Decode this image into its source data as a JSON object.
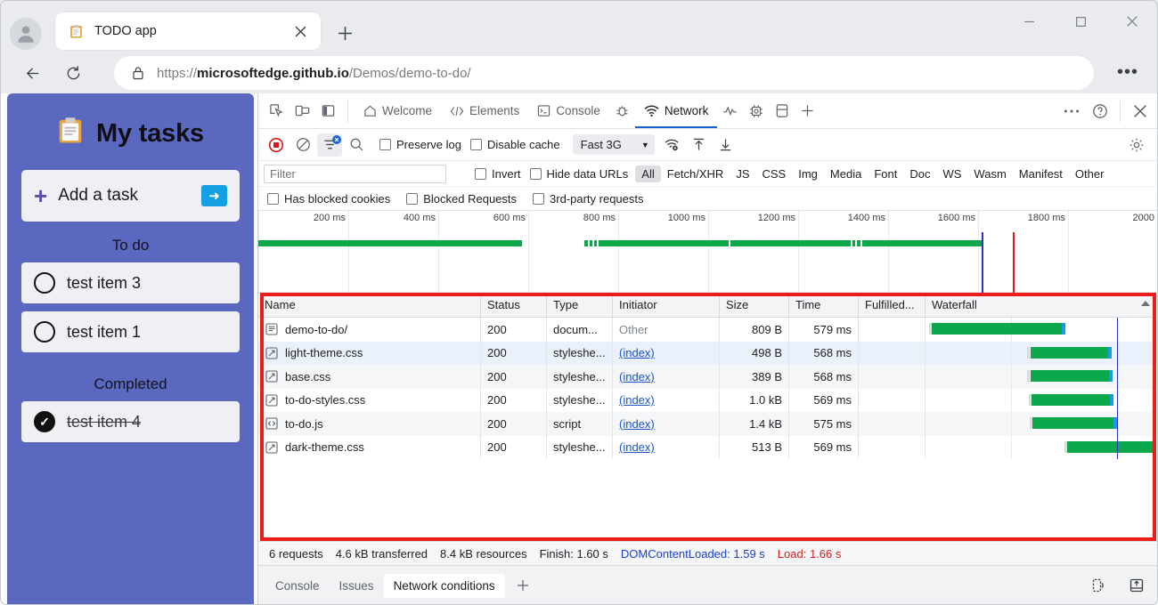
{
  "browser": {
    "tab": {
      "title": "TODO app",
      "favicon": "clipboard-icon"
    },
    "address": {
      "url_full": "https://microsoftedge.github.io/Demos/demo-to-do/",
      "url_host": "microsoftedge.github.io",
      "url_scheme": "https://",
      "url_path": "/Demos/demo-to-do/"
    },
    "buttons": {
      "back": "back-arrow",
      "reload": "reload",
      "newtab": "+",
      "more": "•••",
      "minimize": "—",
      "maximize": "□",
      "close": "✕"
    }
  },
  "todo": {
    "title": "My tasks",
    "add_label": "Add a task",
    "sections": [
      {
        "label": "To do",
        "items": [
          {
            "text": "test item 3",
            "done": false
          },
          {
            "text": "test item 1",
            "done": false
          }
        ]
      },
      {
        "label": "Completed",
        "items": [
          {
            "text": "test item 4",
            "done": true
          }
        ]
      }
    ]
  },
  "devtools": {
    "panel_tabs": [
      {
        "label": "Welcome",
        "icon": "home-icon",
        "active": false
      },
      {
        "label": "Elements",
        "icon": "code-icon",
        "active": false
      },
      {
        "label": "Console",
        "icon": "console-icon",
        "active": false
      },
      {
        "label": "Network",
        "icon": "network-wifi-icon",
        "active": true
      }
    ],
    "left_icons": [
      "inspect-element-icon",
      "device-toolbar-icon",
      "dock-side-icon"
    ],
    "extra_icons": [
      "debugger-bug-icon",
      "sources-icon",
      "performance-chip-icon",
      "application-icon",
      "add-panel-icon"
    ],
    "right_icons": [
      "more-tools-icon",
      "help-icon",
      "close-devtools-icon"
    ],
    "network_toolbar": {
      "record_label": "record-stop",
      "clear_label": "clear",
      "filter_label": "filter",
      "search_label": "search",
      "preserve_log": "Preserve log",
      "disable_cache": "Disable cache",
      "throttle_value": "Fast 3G",
      "icons": [
        "network-conditions-icon",
        "import-har-icon",
        "export-har-icon",
        "settings-gear-icon"
      ]
    },
    "filters": {
      "placeholder": "Filter",
      "invert": "Invert",
      "hide_data_urls": "Hide data URLs",
      "types": [
        "All",
        "Fetch/XHR",
        "JS",
        "CSS",
        "Img",
        "Media",
        "Font",
        "Doc",
        "WS",
        "Wasm",
        "Manifest",
        "Other"
      ],
      "selected_type": "All",
      "has_blocked_cookies": "Has blocked cookies",
      "blocked_requests": "Blocked Requests",
      "third_party": "3rd-party requests"
    },
    "overview": {
      "ticks": [
        "200 ms",
        "400 ms",
        "600 ms",
        "800 ms",
        "1000 ms",
        "1200 ms",
        "1400 ms",
        "1600 ms",
        "1800 ms",
        "2000"
      ],
      "dcl_color": "#2a31c8",
      "load_color": "#e01b1b"
    },
    "table": {
      "headers": [
        "Name",
        "Status",
        "Type",
        "Initiator",
        "Size",
        "Time",
        "Fulfilled...",
        "Waterfall"
      ],
      "sort_column": "Waterfall",
      "sort_direction": "ascending",
      "rows": [
        {
          "icon": "document-icon",
          "name": "demo-to-do/",
          "status": "200",
          "type": "docum...",
          "initiator": "Other",
          "initiator_link": false,
          "size": "809 B",
          "time": "579 ms",
          "fulfilled": "",
          "wf_start": 1.5,
          "wf_width": 56
        },
        {
          "icon": "stylesheet-icon",
          "name": "light-theme.css",
          "status": "200",
          "type": "styleshe...",
          "initiator": "(index)",
          "initiator_link": true,
          "size": "498 B",
          "time": "568 ms",
          "fulfilled": "",
          "wf_start": 44,
          "wf_width": 33.5
        },
        {
          "icon": "stylesheet-icon",
          "name": "base.css",
          "status": "200",
          "type": "styleshe...",
          "initiator": "(index)",
          "initiator_link": true,
          "size": "389 B",
          "time": "568 ms",
          "fulfilled": "",
          "wf_start": 44,
          "wf_width": 34
        },
        {
          "icon": "stylesheet-icon",
          "name": "to-do-styles.css",
          "status": "200",
          "type": "styleshe...",
          "initiator": "(index)",
          "initiator_link": true,
          "size": "1.0 kB",
          "time": "569 ms",
          "fulfilled": "",
          "wf_start": 44.5,
          "wf_width": 34
        },
        {
          "icon": "script-icon",
          "name": "to-do.js",
          "status": "200",
          "type": "script",
          "initiator": "(index)",
          "initiator_link": true,
          "size": "1.4 kB",
          "time": "575 ms",
          "fulfilled": "",
          "wf_start": 45,
          "wf_width": 35
        },
        {
          "icon": "stylesheet-icon",
          "name": "dark-theme.css",
          "status": "200",
          "type": "styleshe...",
          "initiator": "(index)",
          "initiator_link": true,
          "size": "513 B",
          "time": "569 ms",
          "fulfilled": "",
          "wf_start": 60,
          "wf_width": 37
        }
      ],
      "highlight_color": "#ee1b1b"
    },
    "status": {
      "requests": "6 requests",
      "transferred": "4.6 kB transferred",
      "resources": "8.4 kB resources",
      "finish": "Finish: 1.60 s",
      "dom_content_loaded": "DOMContentLoaded: 1.59 s",
      "load": "Load: 1.66 s"
    },
    "drawer": {
      "tabs": [
        {
          "label": "Console",
          "active": false
        },
        {
          "label": "Issues",
          "active": false
        },
        {
          "label": "Network conditions",
          "active": true
        }
      ],
      "add_label": "+",
      "right_icons": [
        "devices-icon",
        "dock-bottom-icon"
      ]
    }
  }
}
